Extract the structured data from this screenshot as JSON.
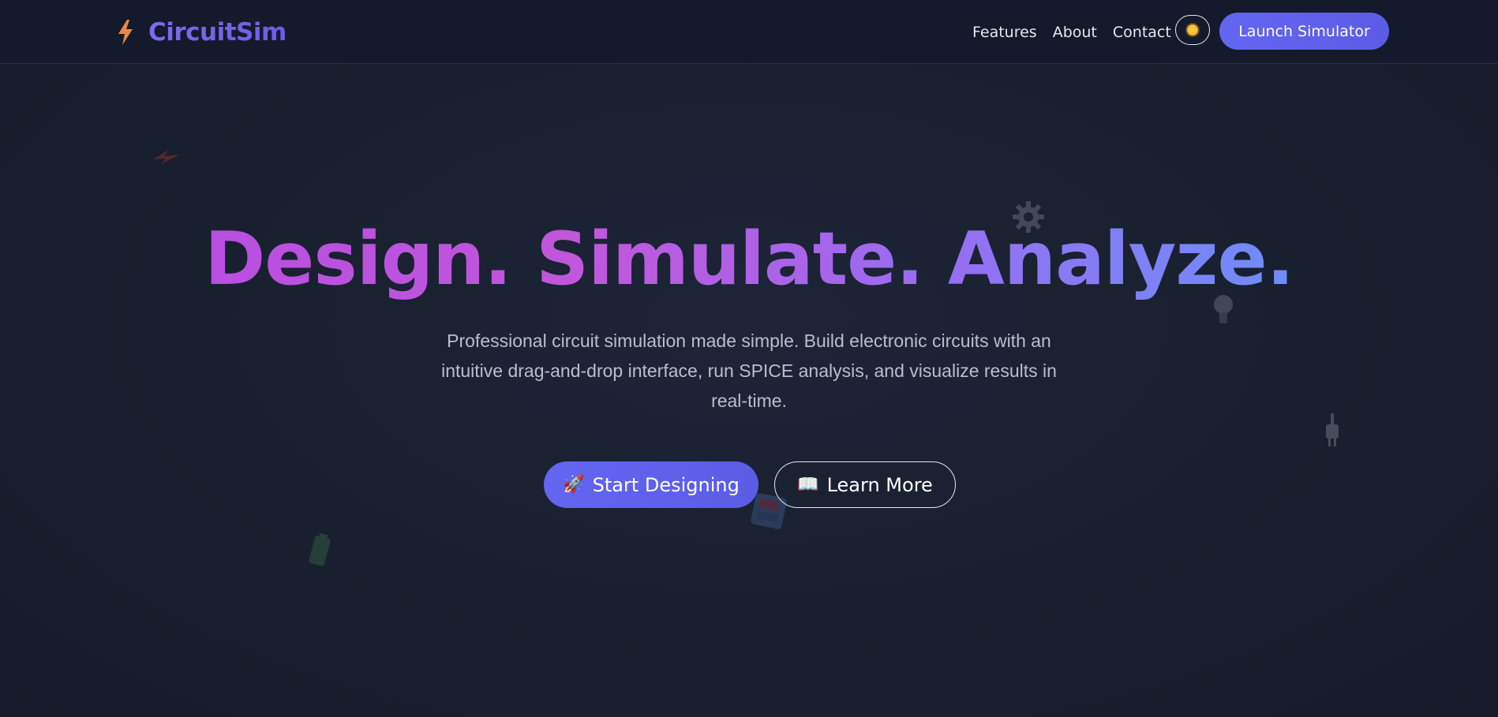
{
  "app": {
    "brand_name": "CircuitSim",
    "brand_icon": "lightning-bolt-icon"
  },
  "nav": {
    "links": [
      "Features",
      "About",
      "Contact"
    ],
    "theme_toggle_icon": "sun-icon",
    "launch_label": "Launch Simulator"
  },
  "hero": {
    "title": "Design. Simulate. Analyze.",
    "subtitle": "Professional circuit simulation made simple. Build electronic circuits with an intuitive drag-and-drop interface, run SPICE analysis, and visualize results in real-time.",
    "primary_emoji": "🚀",
    "primary_label": "Start Designing",
    "secondary_emoji": "📖",
    "secondary_label": "Learn More"
  },
  "decorations": [
    "lightning-icon",
    "gear-icon",
    "lightbulb-icon",
    "plug-icon",
    "battery-icon",
    "chip-icon"
  ],
  "colors": {
    "background": "#18202f",
    "navbar": "#141a2b",
    "accent": "#6366f1",
    "title_gradient_start": "#b84fe0",
    "title_gradient_end": "#6d8ef8"
  }
}
